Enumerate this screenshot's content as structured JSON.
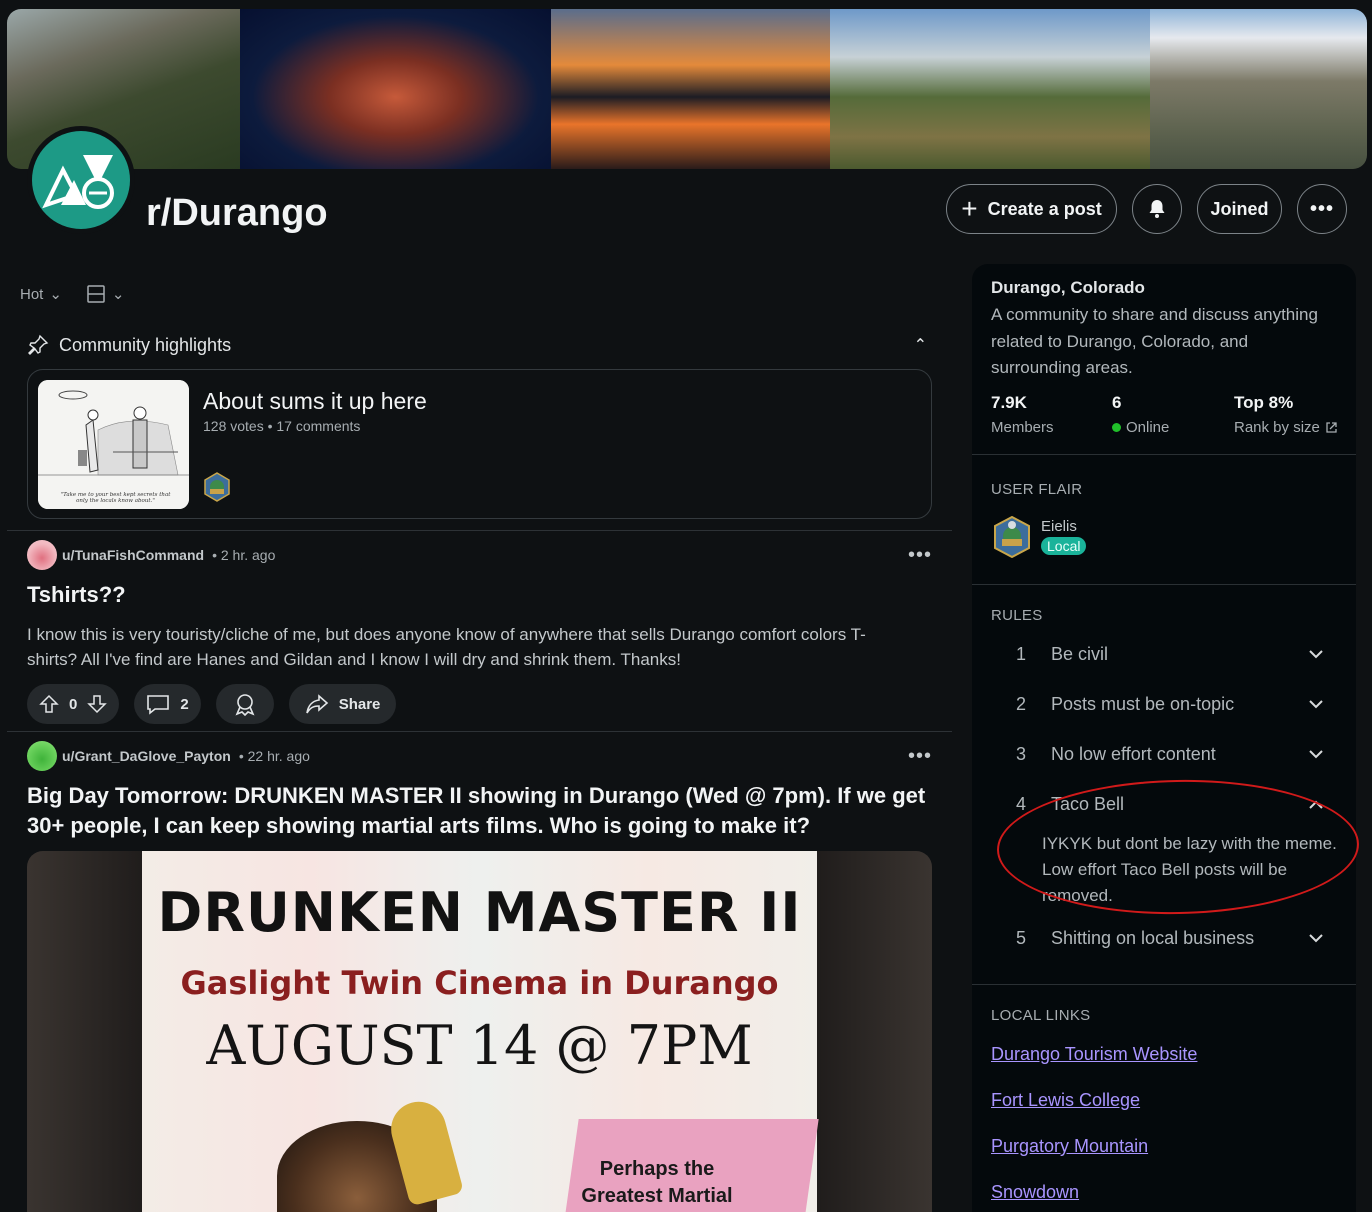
{
  "subreddit": {
    "name": "r/Durango",
    "create_post": "Create a post",
    "joined": "Joined"
  },
  "feed": {
    "sort": "Hot",
    "highlights_label": "Community highlights",
    "highlight": {
      "title": "About sums it up here",
      "meta": "128 votes • 17 comments",
      "caption": "\"Take me to your best kept secrets that only the locals know about.\""
    },
    "posts": [
      {
        "user": "u/TunaFishCommand",
        "time": "• 2 hr. ago",
        "title": "Tshirts??",
        "body": "I know this is very touristy/cliche of me, but does anyone know of anywhere that sells Durango comfort colors T-shirts? All I've find are Hanes and Gildan and I know I will dry and shrink them. Thanks!",
        "votes": "0",
        "comments": "2",
        "share": "Share"
      },
      {
        "user": "u/Grant_DaGlove_Payton",
        "time": "• 22 hr. ago",
        "title": "Big Day Tomorrow: DRUNKEN MASTER II showing in Durango (Wed @ 7pm). If we get 30+ people, I can keep showing martial arts films. Who is going to make it?",
        "poster": {
          "line1": "DRUNKEN MASTER II",
          "line2": "Gaslight Twin Cinema in Durango",
          "line3": "AUGUST 14 @ 7PM",
          "quote": "Perhaps the Greatest Martial"
        }
      }
    ]
  },
  "sidebar": {
    "title": "Durango, Colorado",
    "description": "A community to share and discuss anything related to Durango, Colorado, and surrounding areas.",
    "stats": [
      {
        "value": "7.9K",
        "label": "Members"
      },
      {
        "value": "6",
        "label": "Online"
      },
      {
        "value": "Top 8%",
        "label": "Rank by size"
      }
    ],
    "user_flair_heading": "USER FLAIR",
    "flair_name": "Eielis",
    "flair_badge": "Local",
    "rules_heading": "RULES",
    "rules": [
      {
        "n": "1",
        "text": "Be civil"
      },
      {
        "n": "2",
        "text": "Posts must be on-topic"
      },
      {
        "n": "3",
        "text": "No low effort content"
      },
      {
        "n": "4",
        "text": "Taco Bell"
      },
      {
        "n": "5",
        "text": "Shitting on local business"
      }
    ],
    "rule4_desc": "IYKYK but dont be lazy with the meme. Low effort Taco Bell posts will be removed.",
    "links_heading": "LOCAL LINKS",
    "links": [
      "Durango Tourism Website",
      "Fort Lewis College",
      "Purgatory Mountain",
      "Snowdown"
    ]
  },
  "colors": {
    "background": "#0e1113",
    "accent_teal": "#1d9a86",
    "link": "#a995ff",
    "annotation_circle": "#d11a1a",
    "online_dot": "#20c02a"
  }
}
